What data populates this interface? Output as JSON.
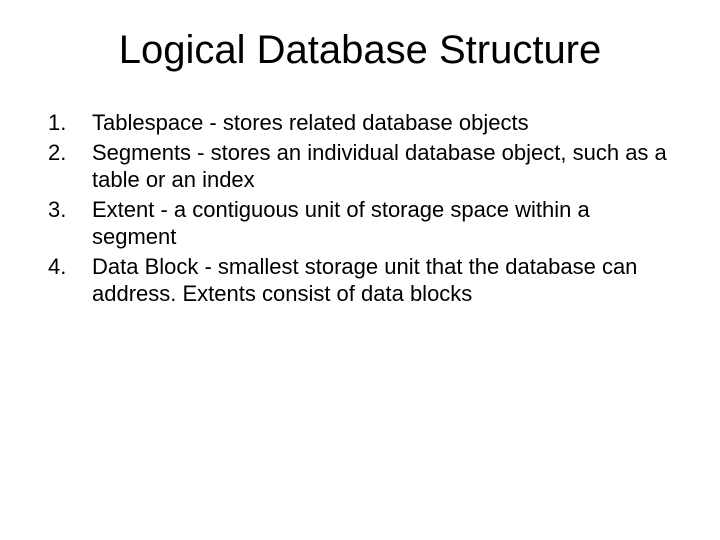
{
  "title": "Logical Database Structure",
  "items": [
    {
      "n": "1.",
      "text": "Tablespace - stores related database objects"
    },
    {
      "n": "2.",
      "text": "Segments - stores an individual database object, such as a table or an index"
    },
    {
      "n": "3.",
      "text": "Extent - a contiguous unit of storage space within a segment"
    },
    {
      "n": "4.",
      "text": "Data Block - smallest storage unit that the database can address. Extents consist of data blocks"
    }
  ]
}
